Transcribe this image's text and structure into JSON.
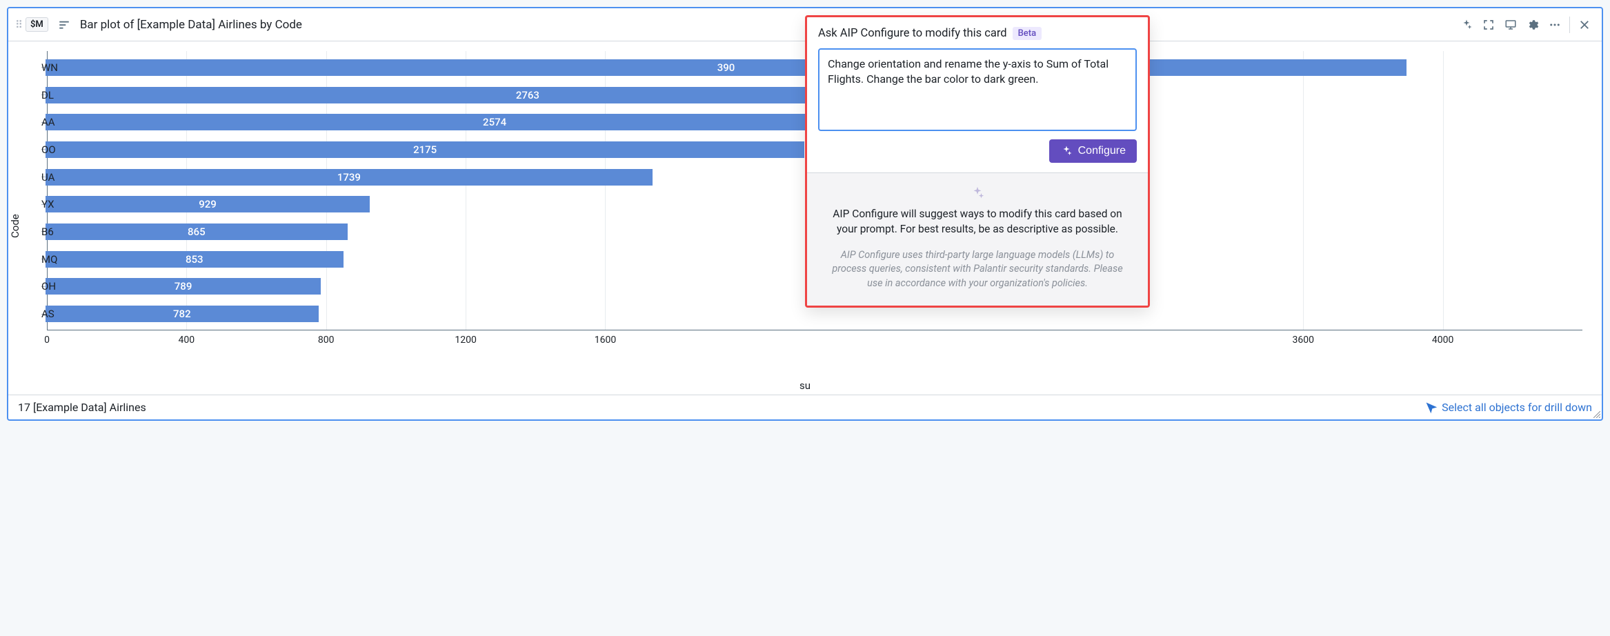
{
  "header": {
    "currency_badge": "$M",
    "title": "Bar plot of [Example Data] Airlines by Code"
  },
  "chart_data": {
    "type": "bar",
    "orientation": "horizontal",
    "ylabel": "Code",
    "xlabel": "su",
    "xlim": [
      0,
      4400
    ],
    "x_ticks": [
      0,
      400,
      800,
      1200,
      1600,
      3600,
      4000
    ],
    "categories": [
      "WN",
      "DL",
      "AA",
      "OO",
      "UA",
      "YX",
      "B6",
      "MQ",
      "OH",
      "AS"
    ],
    "values": [
      3900,
      2763,
      2574,
      2175,
      1739,
      929,
      865,
      853,
      789,
      782
    ],
    "value_labels": [
      "390",
      "2763",
      "2574",
      "2175",
      "1739",
      "929",
      "865",
      "853",
      "789",
      "782"
    ],
    "bar_color": "#5b8ad6"
  },
  "popover": {
    "title": "Ask AIP Configure to modify this card",
    "beta": "Beta",
    "prompt_value": "Change orientation and rename the y-axis to Sum of Total Flights. Change the bar color to dark green.",
    "configure_label": "Configure",
    "help_text": "AIP Configure will suggest ways to modify this card based on your prompt. For best results, be as descriptive as possible.",
    "disclaimer": "AIP Configure uses third-party large language models (LLMs) to process queries, consistent with Palantir security standards. Please use in accordance with your organization's policies."
  },
  "footer": {
    "summary": "17 [Example Data] Airlines",
    "link_label": "Select all objects for drill down"
  }
}
